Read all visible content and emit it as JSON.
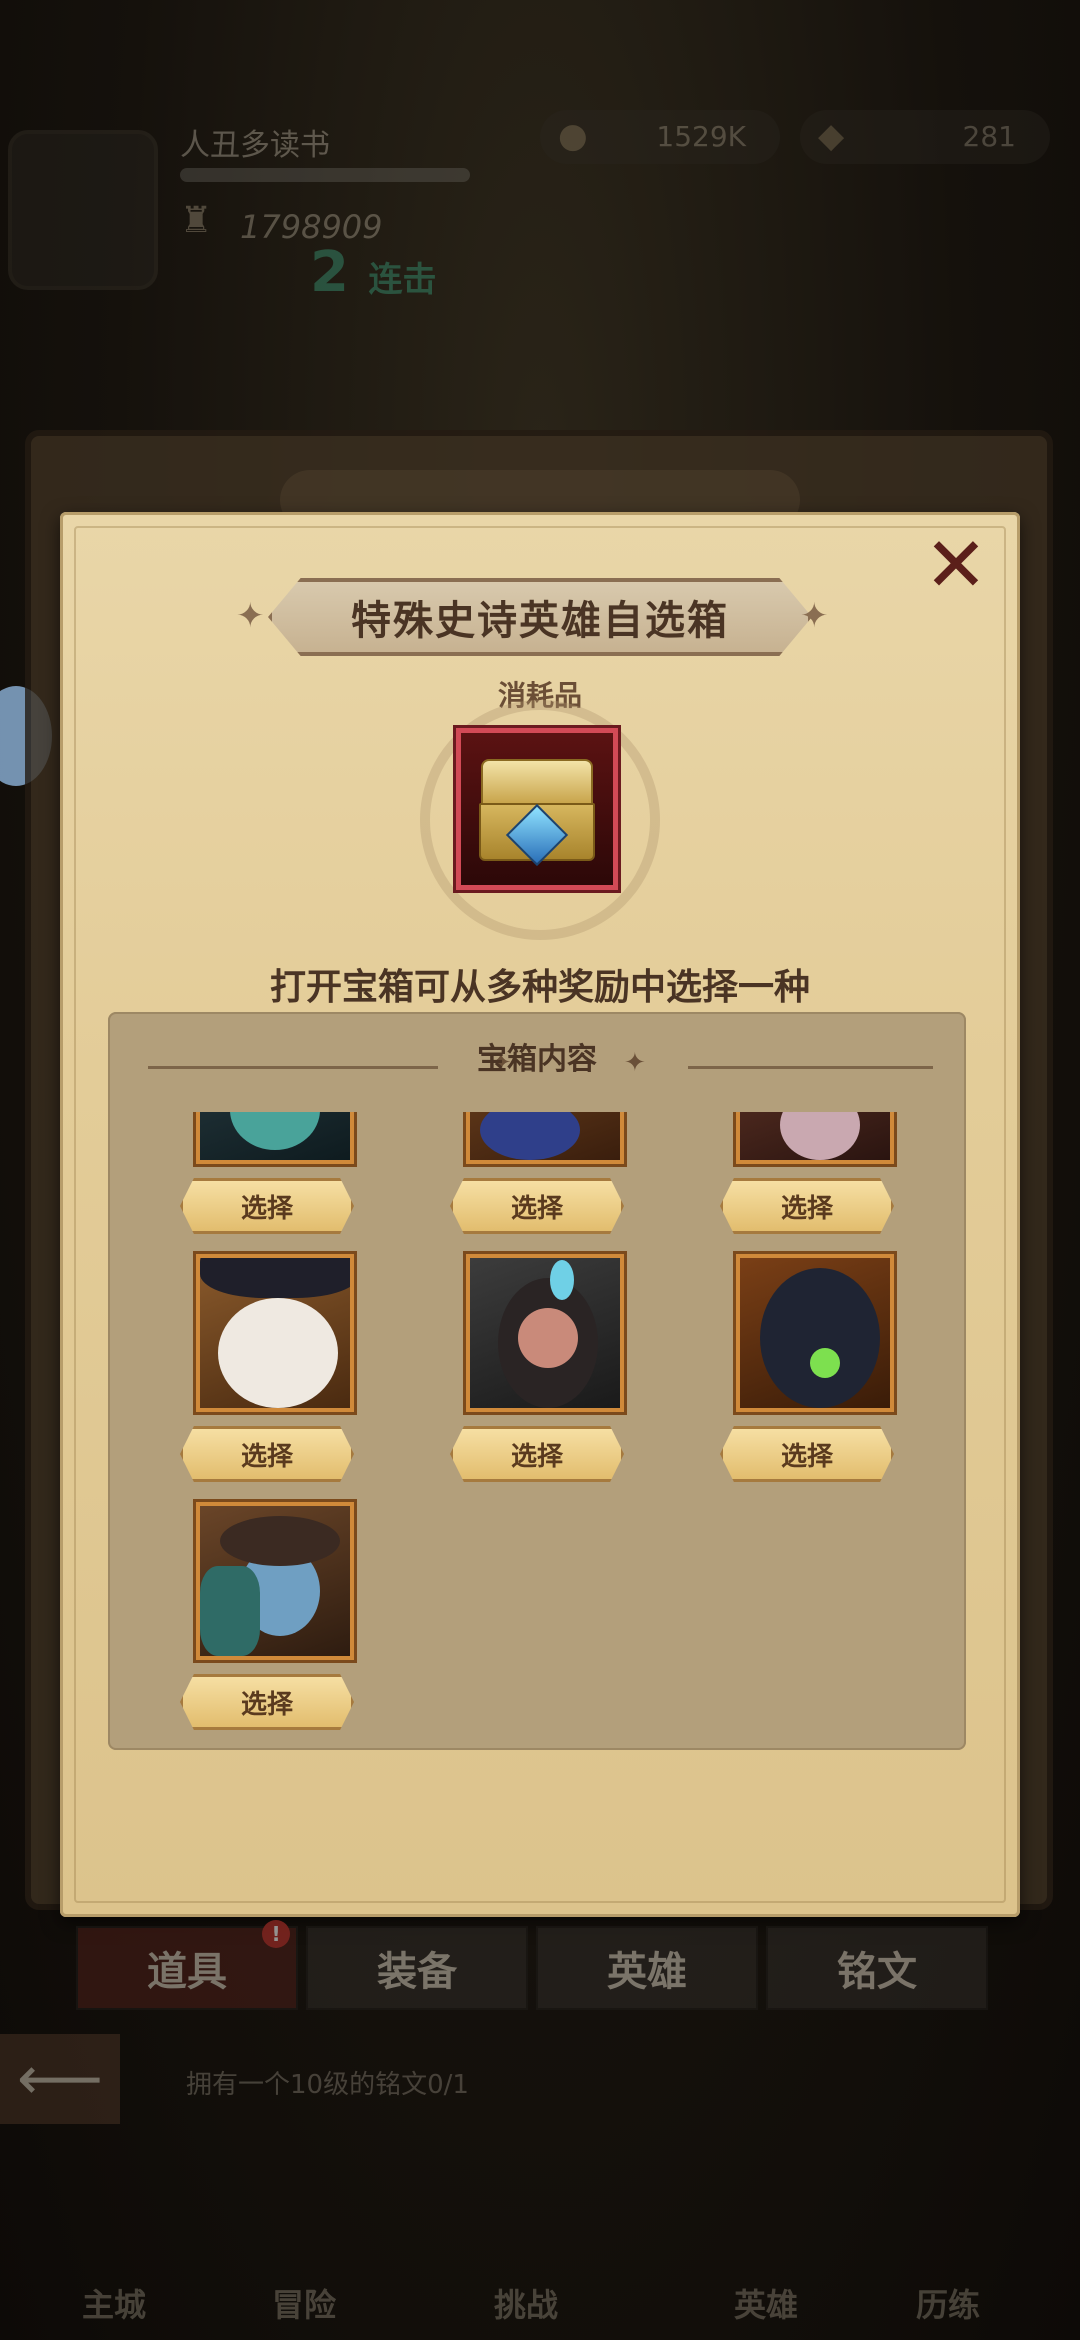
{
  "hud": {
    "player_name": "人丑多读书",
    "power": "1798909",
    "gold": "1529K",
    "gems": "281",
    "combo_count": "2",
    "combo_label": "连击"
  },
  "dialog": {
    "title": "特殊史诗英雄自选箱",
    "category": "消耗品",
    "description": "打开宝箱可从多种奖励中选择一种",
    "section_title": "宝箱内容",
    "close_icon": "close-icon",
    "item_icon": "treasure-chest-icon"
  },
  "heroes": [
    {
      "select_label": "选择"
    },
    {
      "select_label": "选择"
    },
    {
      "select_label": "选择"
    },
    {
      "select_label": "选择"
    },
    {
      "select_label": "选择"
    },
    {
      "select_label": "选择"
    },
    {
      "select_label": "选择"
    }
  ],
  "tabs": [
    {
      "label": "道具",
      "badge": "!"
    },
    {
      "label": "装备"
    },
    {
      "label": "英雄"
    },
    {
      "label": "铭文"
    }
  ],
  "hint": "拥有一个10级的铭文0/1",
  "nav": [
    "主城",
    "冒险",
    "挑战",
    "英雄",
    "历练"
  ],
  "colors": {
    "parchment": "#e3cc98",
    "panel": "#b39f7b",
    "select_button": "#f0d08a",
    "item_frame": "#d24a56",
    "close": "#5b1f1a"
  }
}
